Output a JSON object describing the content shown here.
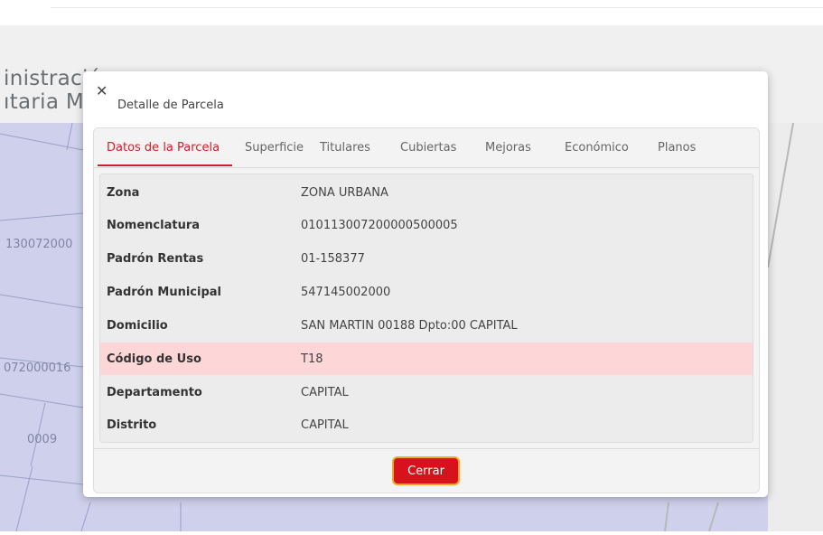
{
  "app": {
    "brand_line1": "inistración",
    "brand_line2": "ıtaria M"
  },
  "map": {
    "labels": [
      "130072000",
      "072000016",
      "0009"
    ]
  },
  "modal": {
    "title": "Detalle de Parcela",
    "close_icon": "close-icon",
    "tabs": [
      {
        "label": "Datos de la Parcela",
        "active": true
      },
      {
        "label": "Superficie",
        "active": false
      },
      {
        "label": "Titulares",
        "active": false
      },
      {
        "label": "Cubiertas",
        "active": false
      },
      {
        "label": "Mejoras",
        "active": false
      },
      {
        "label": "Económico",
        "active": false
      },
      {
        "label": "Planos",
        "active": false
      }
    ],
    "rows": [
      {
        "label": "Zona",
        "value": "ZONA URBANA",
        "highlighted": false
      },
      {
        "label": "Nomenclatura",
        "value": "010113007200000500005",
        "highlighted": false
      },
      {
        "label": "Padrón Rentas",
        "value": "01-158377",
        "highlighted": false
      },
      {
        "label": "Padrón Municipal",
        "value": "547145002000",
        "highlighted": false
      },
      {
        "label": "Domicilio",
        "value": "SAN MARTIN 00188 Dpto:00 CAPITAL",
        "highlighted": false
      },
      {
        "label": "Código de Uso",
        "value": "T18",
        "highlighted": true
      },
      {
        "label": "Departamento",
        "value": "CAPITAL",
        "highlighted": false
      },
      {
        "label": "Distrito",
        "value": "CAPITAL",
        "highlighted": false
      }
    ],
    "close_button": "Cerrar"
  },
  "colors": {
    "accent": "#cf1f2a",
    "button": "#d8121c",
    "button_focus": "#f5a623",
    "highlight_row": "#fdd6d7",
    "map": "#cfd1ec"
  }
}
